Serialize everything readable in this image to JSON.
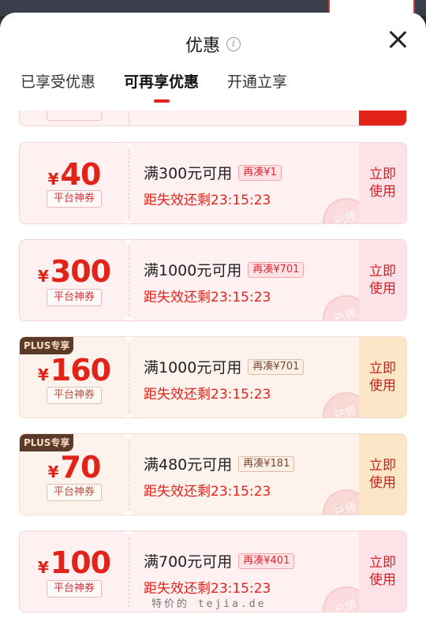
{
  "header": {
    "title": "优惠",
    "info_icon": "info-icon",
    "close_icon": "close-icon"
  },
  "tabs": [
    {
      "label": "已享受优惠",
      "active": false
    },
    {
      "label": "可再享优惠",
      "active": true
    },
    {
      "label": "开通立享",
      "active": false
    }
  ],
  "colors": {
    "accent": "#e2231a",
    "plus_badge": "#5b3a2a"
  },
  "coupons": [
    {
      "plus": false,
      "plus_label": "",
      "currency": "¥",
      "amount": "40",
      "category": "平台神券",
      "condition": "满300元可用",
      "still_need": "再凑¥1",
      "expire": "距失效还剩23:15:23",
      "action": "立即使用",
      "stamp": "已领"
    },
    {
      "plus": false,
      "plus_label": "",
      "currency": "¥",
      "amount": "300",
      "category": "平台神券",
      "condition": "满1000元可用",
      "still_need": "再凑¥701",
      "expire": "距失效还剩23:15:23",
      "action": "立即使用",
      "stamp": "已领"
    },
    {
      "plus": true,
      "plus_label": "PLUS专享",
      "currency": "¥",
      "amount": "160",
      "category": "平台神券",
      "condition": "满1000元可用",
      "still_need": "再凑¥701",
      "expire": "距失效还剩23:15:23",
      "action": "立即使用",
      "stamp": "已领"
    },
    {
      "plus": true,
      "plus_label": "PLUS专享",
      "currency": "¥",
      "amount": "70",
      "category": "平台神券",
      "condition": "满480元可用",
      "still_need": "再凑¥181",
      "expire": "距失效还剩23:15:23",
      "action": "立即使用",
      "stamp": "已领"
    },
    {
      "plus": false,
      "plus_label": "",
      "currency": "¥",
      "amount": "100",
      "category": "平台神券",
      "condition": "满700元可用",
      "still_need": "再凑¥401",
      "expire": "距失效还剩23:15:23",
      "action": "立即使用",
      "stamp": "已领"
    }
  ],
  "watermark": "特价的 tejia.de"
}
